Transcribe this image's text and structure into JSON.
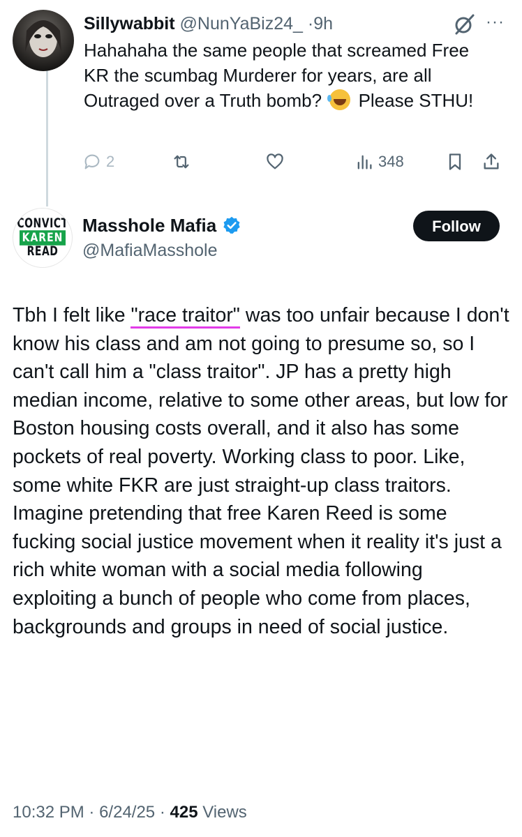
{
  "reply": {
    "author_name": "Sillywabbit",
    "handle": "@NunYaBiz24_",
    "separator": "·",
    "time": "9h",
    "text_before_emoji": "Hahahaha the same people that screamed Free KR the scumbag Murderer for years, are all Outraged over a Truth bomb?",
    "emoji": "rolling-on-floor-laughing-emoji",
    "text_after_emoji": "Please STHU!",
    "more": "···",
    "reply_count": "2",
    "views_count": "348"
  },
  "main": {
    "avatar_text": [
      "CONVICT",
      "KAREN",
      "READ"
    ],
    "author_name": "Masshole Mafia",
    "handle": "@MafiaMasshole",
    "follow_label": "Follow",
    "body_part1_prefix": "Tbh I felt like ",
    "body_part1_highlight": "\"race traitor\"",
    "body_part1_suffix": " was too unfair because I don't know his class and am not going to presume so, so I can't call him a \"class traitor\". JP has a pretty high median income, relative to some other areas, but low for Boston housing costs overall, and it also has some pockets of real poverty. Working class to poor. Like, some white FKR are just straight-up class traitors.",
    "body_part2": "Imagine pretending that free Karen Reed is some fucking social justice movement when it reality it's just a rich white woman with a social media following exploiting a bunch of people who come from places, backgrounds and groups in need of social justice.",
    "timestamp": "10:32 PM",
    "date": "6/24/25",
    "separator": "·",
    "views_count": "425",
    "views_label": "Views"
  },
  "colors": {
    "text": "#0f1419",
    "muted": "#536471",
    "verified": "#1d9bf0",
    "highlight_underline": "#e23ce8",
    "follow_bg": "#0f1419",
    "avatar_green": "#16a34a"
  }
}
